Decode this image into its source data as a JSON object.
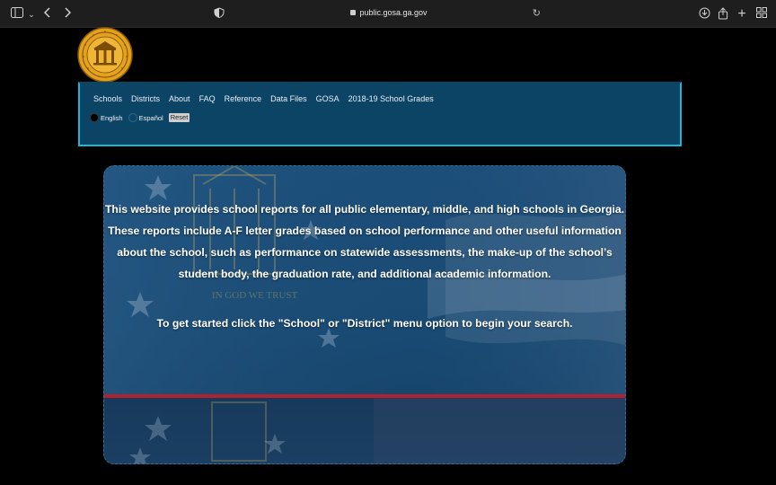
{
  "browser": {
    "url": "public.gosa.ga.gov",
    "icons": [
      "sidebar-icon",
      "chevron-down-icon",
      "back-icon",
      "forward-icon",
      "shield-icon",
      "lock-icon",
      "reload-icon",
      "download-icon",
      "share-icon",
      "new-tab-icon",
      "tab-overview-icon"
    ]
  },
  "nav": {
    "links": [
      "Schools",
      "Districts",
      "About",
      "FAQ",
      "Reference",
      "Data Files",
      "GOSA",
      "2018-19 School Grades"
    ],
    "lang_english": "English",
    "lang_spanish": "Español",
    "reset_label": "Reset"
  },
  "hero": {
    "line1": "This website provides school reports for all public elementary, middle, and high schools in Georgia.",
    "line2": "These reports include A-F letter grades based on school performance and other useful information",
    "line3": "about the school, such as performance on statewide assessments, the make-up of the school’s",
    "line4": "student body, the graduation rate, and additional academic information.",
    "cta": "To get started click the \"School\" or \"District\" menu option to begin your search.",
    "motto": "IN GOD WE TRUST"
  },
  "colors": {
    "nav_bg": "#0c4466",
    "nav_border": "#19b6d6",
    "hero_bg": "#1c4f7b",
    "stripe_red": "#b3212e",
    "seal_gold": "#e3a21a"
  }
}
